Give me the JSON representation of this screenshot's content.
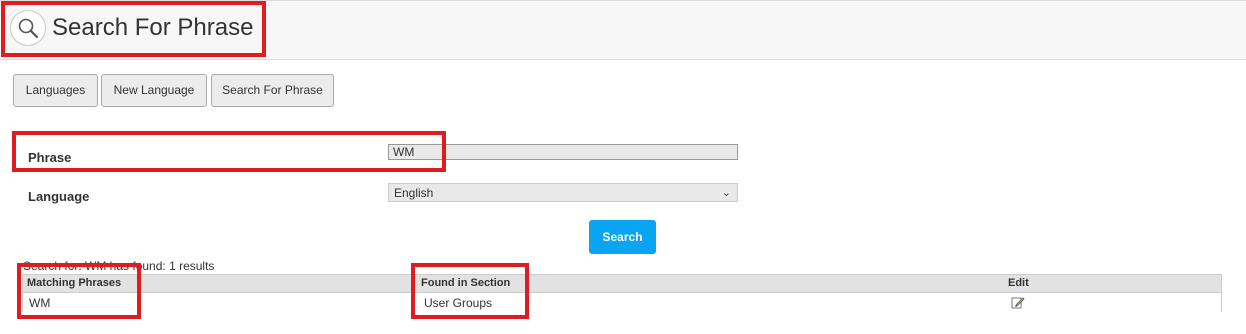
{
  "header": {
    "title": "Search For Phrase",
    "icon": "magnifier-icon"
  },
  "tabs": [
    {
      "label": "Languages"
    },
    {
      "label": "New Language"
    },
    {
      "label": "Search For Phrase"
    }
  ],
  "form": {
    "phrase_label": "Phrase",
    "phrase_value": "WM",
    "language_label": "Language",
    "language_selected": "English",
    "search_label": "Search"
  },
  "results": {
    "summary": "Search for: WM has found: 1 results",
    "columns": [
      "Matching Phrases",
      "Found in Section",
      "Edit"
    ],
    "rows": [
      {
        "phrase": "WM",
        "section": "User Groups",
        "edit_icon": "edit-pencil-icon"
      }
    ]
  },
  "colors": {
    "accent": "#0aa5f2",
    "annotation": "#e11b22"
  }
}
